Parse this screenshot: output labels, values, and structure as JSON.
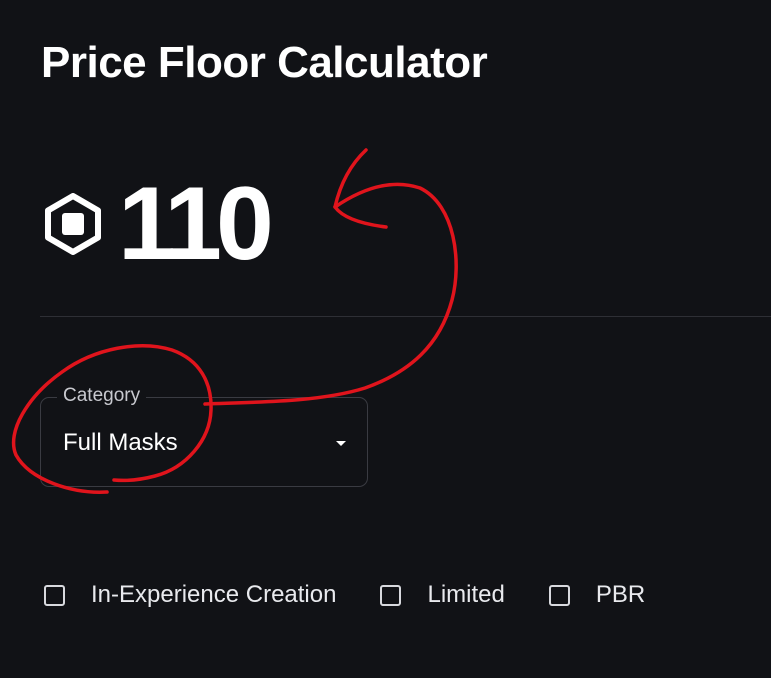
{
  "header": {
    "title": "Price Floor Calculator"
  },
  "price": {
    "currency_icon": "robux-icon",
    "value": "110"
  },
  "category": {
    "label": "Category",
    "selected": "Full Masks"
  },
  "options": [
    {
      "label": "In-Experience Creation",
      "checked": false
    },
    {
      "label": "Limited",
      "checked": false
    },
    {
      "label": "PBR",
      "checked": false
    }
  ],
  "colors": {
    "background": "#111216",
    "text": "#ffffff",
    "annotation": "#e0141c"
  }
}
